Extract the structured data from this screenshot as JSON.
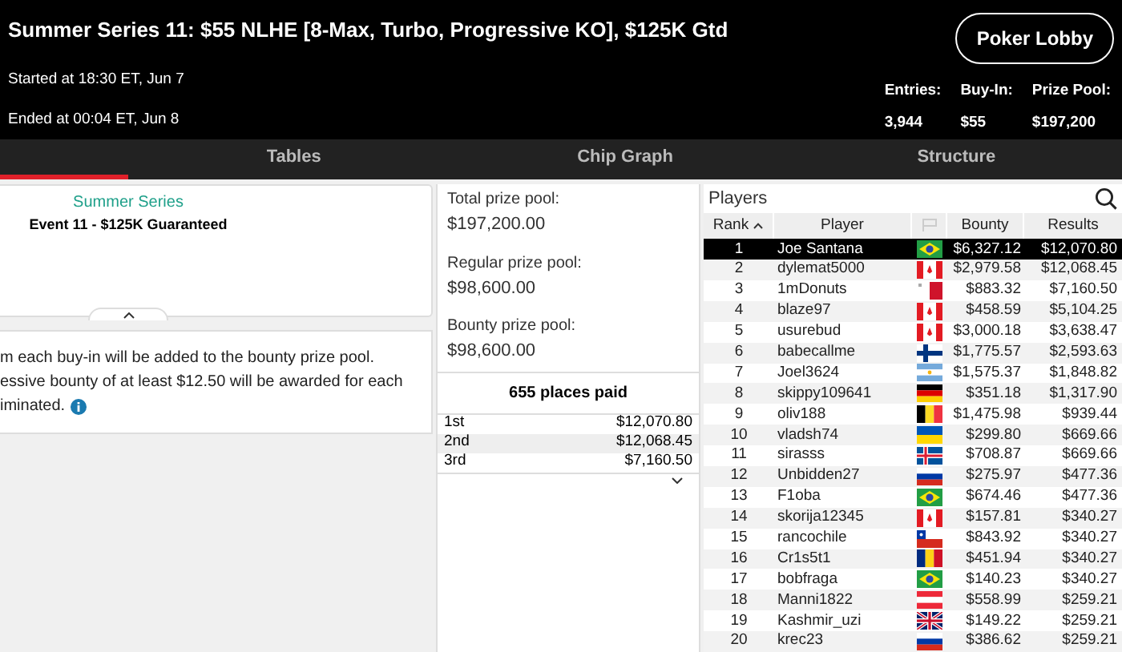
{
  "header": {
    "title": "Summer Series 11: $55 NLHE [8-Max, Turbo, Progressive KO], $125K Gtd",
    "started": "Started at 18:30 ET, Jun 7",
    "ended": "Ended at 00:04 ET, Jun 8",
    "lobby_button": "Poker Lobby",
    "stats": [
      {
        "label": "Entries:",
        "value": "3,944"
      },
      {
        "label": "Buy-In:",
        "value": "$55"
      },
      {
        "label": "Prize Pool:",
        "value": "$197,200"
      }
    ]
  },
  "tabs": [
    {
      "selected": true
    },
    {
      "label": "Tables",
      "selected": false
    },
    {
      "label": "Chip Graph",
      "selected": false
    },
    {
      "label": "Structure",
      "selected": false
    }
  ],
  "event_card": {
    "series": "Summer Series",
    "event": "Event 11 - $125K Guaranteed"
  },
  "description_lines": [
    "m each buy-in will be added to the bounty prize pool.",
    "essive bounty of at least $12.50 will be awarded for each",
    "iminated."
  ],
  "prize_pools": [
    {
      "label": "Total prize pool:",
      "value": "$197,200.00"
    },
    {
      "label": "Regular prize pool:",
      "value": "$98,600.00"
    },
    {
      "label": "Bounty prize pool:",
      "value": "$98,600.00"
    }
  ],
  "payouts": {
    "title": "655 places paid",
    "rows": [
      {
        "place": "1st",
        "amount": "$12,070.80"
      },
      {
        "place": "2nd",
        "amount": "$12,068.45"
      },
      {
        "place": "3rd",
        "amount": "$7,160.50"
      }
    ]
  },
  "players": {
    "title": "Players",
    "columns": [
      "Rank",
      "Player",
      "Bounty",
      "Results"
    ],
    "rows": [
      {
        "rank": "1",
        "name": "Joe Santana",
        "kind": "brazil",
        "bounty": "$6,327.12",
        "result": "$12,070.80",
        "selected": true
      },
      {
        "rank": "2",
        "name": "dylemat5000",
        "kind": "canada",
        "bounty": "$2,979.58",
        "result": "$12,068.45",
        "selected": false
      },
      {
        "rank": "3",
        "name": "1mDonuts",
        "kind": "malta",
        "bounty": "$883.32",
        "result": "$7,160.50",
        "selected": false
      },
      {
        "rank": "4",
        "name": "blaze97",
        "kind": "canada",
        "bounty": "$458.59",
        "result": "$5,104.25",
        "selected": false
      },
      {
        "rank": "5",
        "name": "usurebud",
        "kind": "canada",
        "bounty": "$3,000.18",
        "result": "$3,638.47",
        "selected": false
      },
      {
        "rank": "6",
        "name": "babecallme",
        "kind": "finland",
        "bounty": "$1,775.57",
        "result": "$2,593.63",
        "selected": false
      },
      {
        "rank": "7",
        "name": "Joel3624",
        "kind": "argentina",
        "bounty": "$1,575.37",
        "result": "$1,848.82",
        "selected": false
      },
      {
        "rank": "8",
        "name": "skippy109641",
        "kind": "germany",
        "bounty": "$351.18",
        "result": "$1,317.90",
        "selected": false
      },
      {
        "rank": "9",
        "name": "oliv188",
        "kind": "belgium",
        "bounty": "$1,475.98",
        "result": "$939.44",
        "selected": false
      },
      {
        "rank": "10",
        "name": "vladsh74",
        "kind": "ukraine",
        "bounty": "$299.80",
        "result": "$669.66",
        "selected": false
      },
      {
        "rank": "11",
        "name": "sirasss",
        "kind": "iceland",
        "bounty": "$708.87",
        "result": "$669.66",
        "selected": false
      },
      {
        "rank": "12",
        "name": "Unbidden27",
        "kind": "russia",
        "bounty": "$275.97",
        "result": "$477.36",
        "selected": false
      },
      {
        "rank": "13",
        "name": "F1oba",
        "kind": "brazil",
        "bounty": "$674.46",
        "result": "$477.36",
        "selected": false
      },
      {
        "rank": "14",
        "name": "skorija12345",
        "kind": "canada",
        "bounty": "$157.81",
        "result": "$340.27",
        "selected": false
      },
      {
        "rank": "15",
        "name": "rancochile",
        "kind": "chile",
        "bounty": "$843.92",
        "result": "$340.27",
        "selected": false
      },
      {
        "rank": "16",
        "name": "Cr1s5t1",
        "kind": "romania",
        "bounty": "$451.94",
        "result": "$340.27",
        "selected": false
      },
      {
        "rank": "17",
        "name": "bobfraga",
        "kind": "brazil",
        "bounty": "$140.23",
        "result": "$340.27",
        "selected": false
      },
      {
        "rank": "18",
        "name": "Manni1822",
        "kind": "austria",
        "bounty": "$558.99",
        "result": "$259.21",
        "selected": false
      },
      {
        "rank": "19",
        "name": "Kashmir_uzi",
        "kind": "uk",
        "bounty": "$149.22",
        "result": "$259.21",
        "selected": false
      },
      {
        "rank": "20",
        "name": "krec23",
        "kind": "russia",
        "bounty": "$386.62",
        "result": "$259.21",
        "selected": false
      }
    ]
  }
}
